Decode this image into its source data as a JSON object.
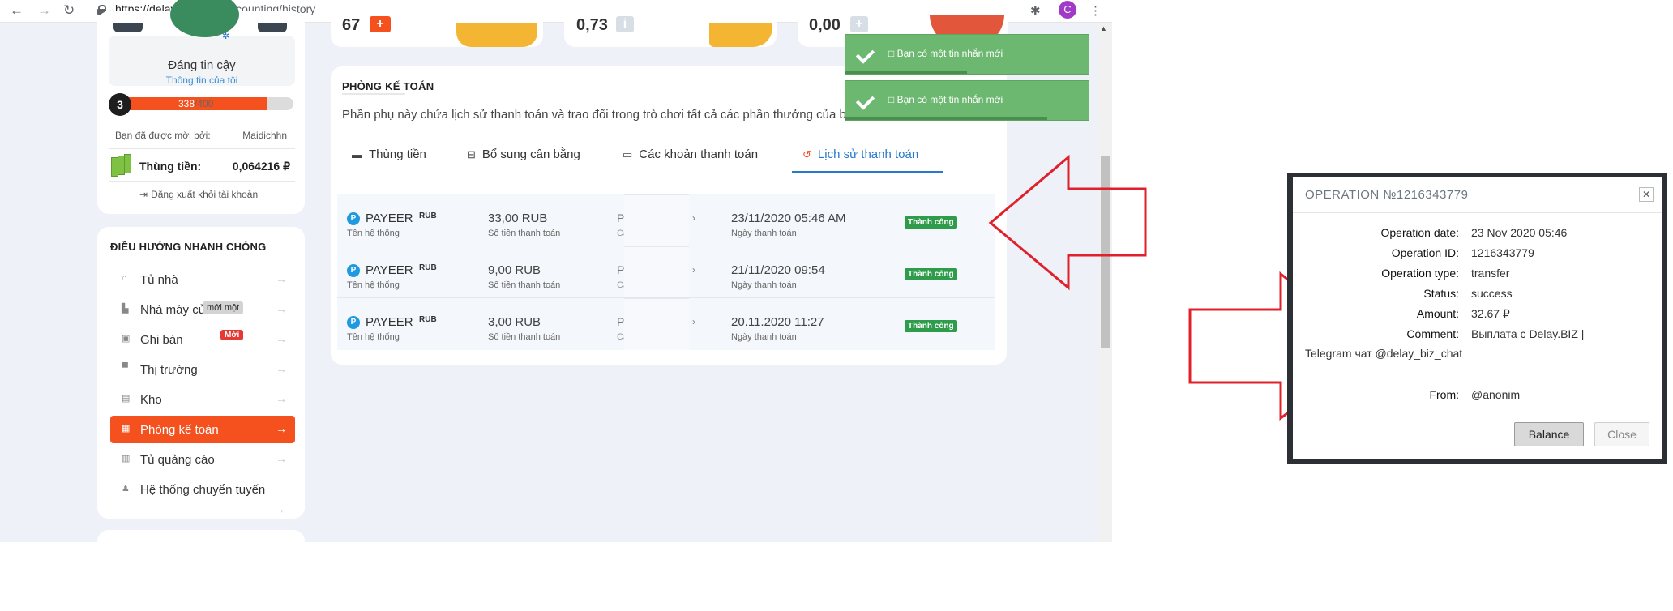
{
  "browser": {
    "url_host": "https://delay.biz",
    "url_path": "/cabinet/counting/history",
    "profile_initial": "C"
  },
  "profile": {
    "status": "Đáng tin cậy",
    "my_info_link": "Thông tin của tôi",
    "level": "3",
    "exp_current": "338",
    "exp_max": "/400",
    "exp_fraction": 0.845,
    "invited_label": "Bạn đã được mời bởi:",
    "inviter": "Maidichhn",
    "cash_label": "Thùng tiền:",
    "cash_value": "0,064216 ₽",
    "logout": "Đăng xuất khỏi tài khoản"
  },
  "quick_nav": {
    "title": "ĐIỀU HƯỚNG NHANH CHÓNG",
    "items": [
      {
        "label": "Tủ nhà"
      },
      {
        "label": "Nhà máy của tôi"
      },
      {
        "label": "Ghi bàn"
      },
      {
        "label": "Thị trường"
      },
      {
        "label": "Kho"
      },
      {
        "label": "Phòng kế toán"
      },
      {
        "label": "Tủ quảng cáo"
      },
      {
        "label": "Hệ thống chuyển tuyến"
      }
    ],
    "new_badge": "Mới",
    "tooltip": "mới một"
  },
  "stats": {
    "s1": "67",
    "s2": "0,73",
    "s3": "0,00"
  },
  "accounting": {
    "title": "PHÒNG KẾ TOÁN",
    "description": "Phần phụ này chứa lịch sử thanh toán và trao đổi trong trò chơi tất cả các phần thưởng của bạn",
    "tabs": [
      "Thùng tiền",
      "Bổ sung cân bằng",
      "Các khoản thanh toán",
      "Lịch sử thanh toán"
    ],
    "active_tab": "Lịch sử thanh toán",
    "rows": [
      {
        "system": "PAYEER",
        "currency": "RUB",
        "system_sub": "Tên hệ thống",
        "amount": "33,00 RUB",
        "amount_sub": "Số tiền thanh toán",
        "col3": "P",
        "col3_sub": "Cá",
        "date": "23/11/2020 05:46 AM",
        "date_sub": "Ngày thanh toán",
        "status": "Thành công"
      },
      {
        "system": "PAYEER",
        "currency": "RUB",
        "system_sub": "Tên hệ thống",
        "amount": "9,00 RUB",
        "amount_sub": "Số tiền thanh toán",
        "col3": "P",
        "col3_sub": "Cá",
        "date": "21/11/2020 09:54",
        "date_sub": "Ngày thanh toán",
        "status": "Thành công"
      },
      {
        "system": "PAYEER",
        "currency": "RUB",
        "system_sub": "Tên hệ thống",
        "amount": "3,00 RUB",
        "amount_sub": "Số tiền thanh toán",
        "col3": "P",
        "col3_sub": "Cá",
        "date": "20.11.2020 11:27",
        "date_sub": "Ngày thanh toán",
        "status": "Thành công"
      }
    ]
  },
  "notifications": [
    {
      "text": "□ Bạn có một tin nhắn mới",
      "progress": 0.5
    },
    {
      "text": "□ Bạn có một tin nhắn mới",
      "progress": 0.83
    }
  ],
  "dialog": {
    "title": "OPERATION №1216343779",
    "fields": [
      {
        "k": "Operation date:",
        "v": "23 Nov 2020 05:46"
      },
      {
        "k": "Operation ID:",
        "v": "1216343779"
      },
      {
        "k": "Operation type:",
        "v": "transfer"
      },
      {
        "k": "Status:",
        "v": "success"
      },
      {
        "k": "Amount:",
        "v": "32.67 ₽"
      },
      {
        "k": "Comment:",
        "v": "Выплата с Delay.BIZ |"
      },
      {
        "k": "From:",
        "v": "@anonim"
      }
    ],
    "comment_wrap": "Telegram чат @delay_biz_chat",
    "balance_button": "Balance",
    "close_button": "Close"
  },
  "colors": {
    "accent": "#f4511e",
    "link": "#2979c9",
    "success": "#2e9c4a",
    "notification": "#6db870",
    "arrow": "#e0202a"
  }
}
